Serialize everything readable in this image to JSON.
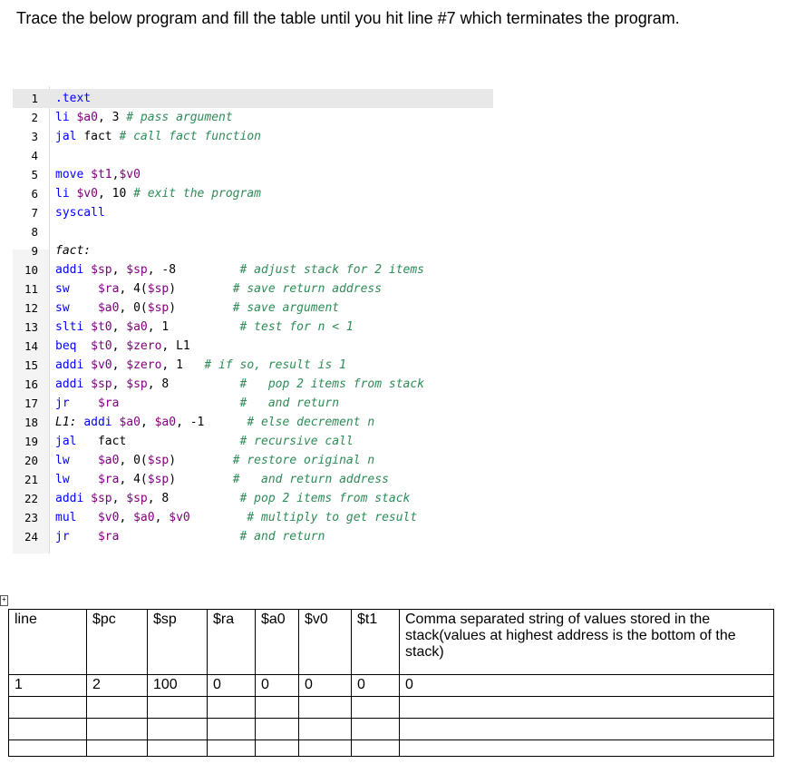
{
  "prompt": "Trace the below program and fill the table until you hit line #7 which terminates the program.",
  "code_lines": [
    {
      "n": "1",
      "tokens": [
        {
          "t": ".text",
          "c": "kw"
        }
      ]
    },
    {
      "n": "2",
      "tokens": [
        {
          "t": "li ",
          "c": "kw"
        },
        {
          "t": "$a0",
          "c": "reg"
        },
        {
          "t": ", 3 ",
          "c": "plain"
        },
        {
          "t": "# pass argument",
          "c": "cm"
        }
      ]
    },
    {
      "n": "3",
      "tokens": [
        {
          "t": "jal ",
          "c": "kw"
        },
        {
          "t": "fact ",
          "c": "plain"
        },
        {
          "t": "# call fact function",
          "c": "cm"
        }
      ]
    },
    {
      "n": "4",
      "tokens": []
    },
    {
      "n": "5",
      "tokens": [
        {
          "t": "move ",
          "c": "kw"
        },
        {
          "t": "$t1",
          "c": "reg"
        },
        {
          "t": ",",
          "c": "plain"
        },
        {
          "t": "$v0",
          "c": "reg"
        }
      ]
    },
    {
      "n": "6",
      "tokens": [
        {
          "t": "li ",
          "c": "kw"
        },
        {
          "t": "$v0",
          "c": "reg"
        },
        {
          "t": ", 10 ",
          "c": "plain"
        },
        {
          "t": "# exit the program",
          "c": "cm"
        }
      ]
    },
    {
      "n": "7",
      "tokens": [
        {
          "t": "syscall",
          "c": "kw"
        }
      ]
    },
    {
      "n": "8",
      "tokens": []
    },
    {
      "n": "9",
      "tokens": [
        {
          "t": "fact:",
          "c": "lbl"
        }
      ]
    },
    {
      "n": "10",
      "tokens": [
        {
          "t": "addi ",
          "c": "kw"
        },
        {
          "t": "$sp",
          "c": "reg"
        },
        {
          "t": ", ",
          "c": "plain"
        },
        {
          "t": "$sp",
          "c": "reg"
        },
        {
          "t": ", -8         ",
          "c": "plain"
        },
        {
          "t": "# adjust stack for 2 items",
          "c": "cm"
        }
      ]
    },
    {
      "n": "11",
      "tokens": [
        {
          "t": "sw    ",
          "c": "kw"
        },
        {
          "t": "$ra",
          "c": "reg"
        },
        {
          "t": ", 4(",
          "c": "plain"
        },
        {
          "t": "$sp",
          "c": "reg"
        },
        {
          "t": ")        ",
          "c": "plain"
        },
        {
          "t": "# save return address",
          "c": "cm"
        }
      ]
    },
    {
      "n": "12",
      "tokens": [
        {
          "t": "sw    ",
          "c": "kw"
        },
        {
          "t": "$a0",
          "c": "reg"
        },
        {
          "t": ", 0(",
          "c": "plain"
        },
        {
          "t": "$sp",
          "c": "reg"
        },
        {
          "t": ")        ",
          "c": "plain"
        },
        {
          "t": "# save argument",
          "c": "cm"
        }
      ]
    },
    {
      "n": "13",
      "tokens": [
        {
          "t": "slti ",
          "c": "kw"
        },
        {
          "t": "$t0",
          "c": "reg"
        },
        {
          "t": ", ",
          "c": "plain"
        },
        {
          "t": "$a0",
          "c": "reg"
        },
        {
          "t": ", 1          ",
          "c": "plain"
        },
        {
          "t": "# test for n < 1",
          "c": "cm"
        }
      ]
    },
    {
      "n": "14",
      "tokens": [
        {
          "t": "beq  ",
          "c": "kw"
        },
        {
          "t": "$t0",
          "c": "reg"
        },
        {
          "t": ", ",
          "c": "plain"
        },
        {
          "t": "$zero",
          "c": "reg"
        },
        {
          "t": ", L1",
          "c": "plain"
        }
      ]
    },
    {
      "n": "15",
      "tokens": [
        {
          "t": "addi ",
          "c": "kw"
        },
        {
          "t": "$v0",
          "c": "reg"
        },
        {
          "t": ", ",
          "c": "plain"
        },
        {
          "t": "$zero",
          "c": "reg"
        },
        {
          "t": ", 1   ",
          "c": "plain"
        },
        {
          "t": "# if so, result is 1",
          "c": "cm"
        }
      ]
    },
    {
      "n": "16",
      "tokens": [
        {
          "t": "addi ",
          "c": "kw"
        },
        {
          "t": "$sp",
          "c": "reg"
        },
        {
          "t": ", ",
          "c": "plain"
        },
        {
          "t": "$sp",
          "c": "reg"
        },
        {
          "t": ", 8          ",
          "c": "plain"
        },
        {
          "t": "#   pop 2 items from stack",
          "c": "cm"
        }
      ]
    },
    {
      "n": "17",
      "tokens": [
        {
          "t": "jr    ",
          "c": "kw"
        },
        {
          "t": "$ra",
          "c": "reg"
        },
        {
          "t": "                 ",
          "c": "plain"
        },
        {
          "t": "#   and return",
          "c": "cm"
        }
      ]
    },
    {
      "n": "18",
      "tokens": [
        {
          "t": "L1: ",
          "c": "lbl"
        },
        {
          "t": "addi ",
          "c": "kw"
        },
        {
          "t": "$a0",
          "c": "reg"
        },
        {
          "t": ", ",
          "c": "plain"
        },
        {
          "t": "$a0",
          "c": "reg"
        },
        {
          "t": ", -1      ",
          "c": "plain"
        },
        {
          "t": "# else decrement n",
          "c": "cm"
        }
      ]
    },
    {
      "n": "19",
      "tokens": [
        {
          "t": "jal   ",
          "c": "kw"
        },
        {
          "t": "fact",
          "c": "plain"
        },
        {
          "t": "                ",
          "c": "plain"
        },
        {
          "t": "# recursive call",
          "c": "cm"
        }
      ]
    },
    {
      "n": "20",
      "tokens": [
        {
          "t": "lw    ",
          "c": "kw"
        },
        {
          "t": "$a0",
          "c": "reg"
        },
        {
          "t": ", 0(",
          "c": "plain"
        },
        {
          "t": "$sp",
          "c": "reg"
        },
        {
          "t": ")        ",
          "c": "plain"
        },
        {
          "t": "# restore original n",
          "c": "cm"
        }
      ]
    },
    {
      "n": "21",
      "tokens": [
        {
          "t": "lw    ",
          "c": "kw"
        },
        {
          "t": "$ra",
          "c": "reg"
        },
        {
          "t": ", 4(",
          "c": "plain"
        },
        {
          "t": "$sp",
          "c": "reg"
        },
        {
          "t": ")        ",
          "c": "plain"
        },
        {
          "t": "#   and return address",
          "c": "cm"
        }
      ]
    },
    {
      "n": "22",
      "tokens": [
        {
          "t": "addi ",
          "c": "kw"
        },
        {
          "t": "$sp",
          "c": "reg"
        },
        {
          "t": ", ",
          "c": "plain"
        },
        {
          "t": "$sp",
          "c": "reg"
        },
        {
          "t": ", 8          ",
          "c": "plain"
        },
        {
          "t": "# pop 2 items from stack",
          "c": "cm"
        }
      ]
    },
    {
      "n": "23",
      "tokens": [
        {
          "t": "mul   ",
          "c": "kw"
        },
        {
          "t": "$v0",
          "c": "reg"
        },
        {
          "t": ", ",
          "c": "plain"
        },
        {
          "t": "$a0",
          "c": "reg"
        },
        {
          "t": ", ",
          "c": "plain"
        },
        {
          "t": "$v0",
          "c": "reg"
        },
        {
          "t": "        ",
          "c": "plain"
        },
        {
          "t": "# multiply to get result",
          "c": "cm"
        }
      ]
    },
    {
      "n": "24",
      "tokens": [
        {
          "t": "jr    ",
          "c": "kw"
        },
        {
          "t": "$ra",
          "c": "reg"
        },
        {
          "t": "                 ",
          "c": "plain"
        },
        {
          "t": "# and return",
          "c": "cm"
        }
      ]
    }
  ],
  "table": {
    "headers": [
      "line",
      "$pc",
      "$sp",
      "$ra",
      "$a0",
      "$v0",
      "$t1",
      "Comma separated string of values stored in the stack(values at highest address is the bottom of the stack)"
    ],
    "rows": [
      [
        "1",
        "2",
        "100",
        "0",
        "0",
        "0",
        "0",
        "0"
      ],
      [
        "",
        "",
        "",
        "",
        "",
        "",
        "",
        ""
      ],
      [
        "",
        "",
        "",
        "",
        "",
        "",
        "",
        ""
      ],
      [
        "",
        "",
        "",
        "",
        "",
        "",
        "",
        ""
      ]
    ]
  }
}
